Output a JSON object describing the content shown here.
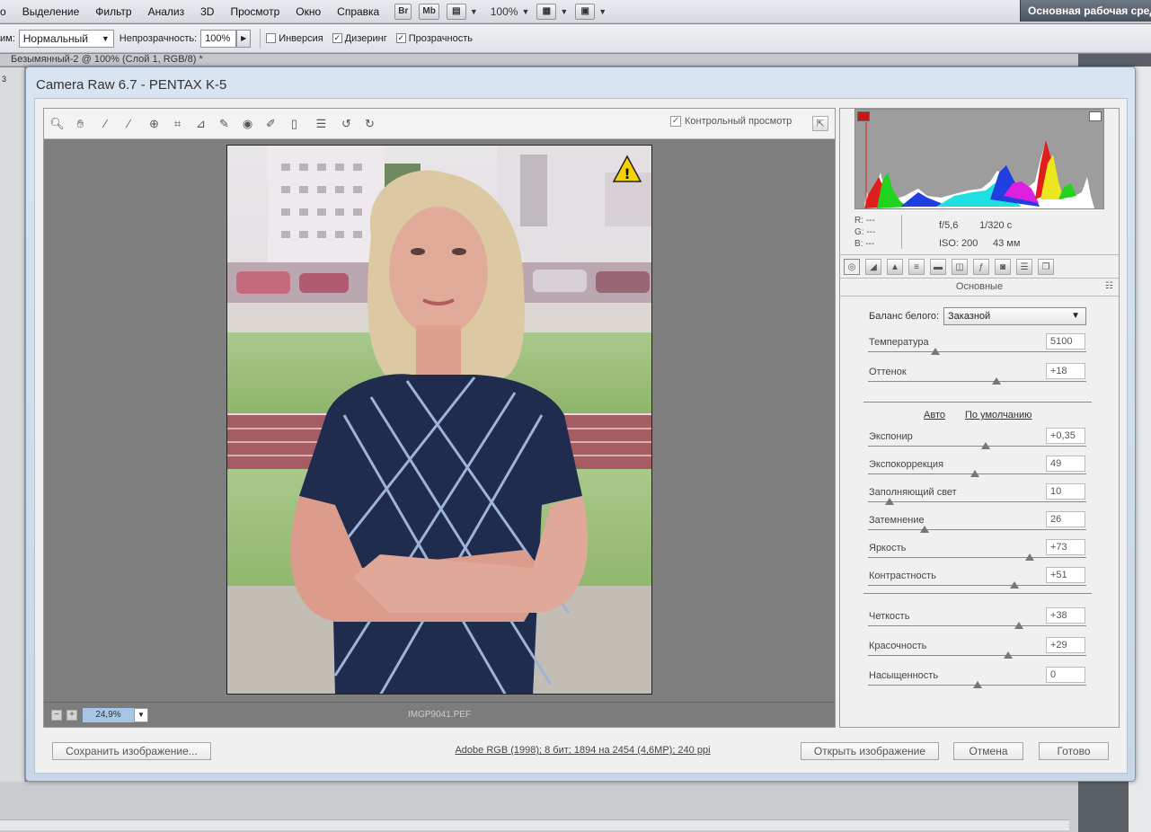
{
  "menubar": {
    "items": [
      "о",
      "Выделение",
      "Фильтр",
      "Анализ",
      "3D",
      "Просмотр",
      "Окно",
      "Справка"
    ],
    "br": "Br",
    "mb": "Mb",
    "zoom": "100%",
    "workspace": "Основная рабочая сред"
  },
  "options": {
    "mode_label": "им:",
    "mode_value": "Нормальный",
    "opacity_label": "Непрозрачность:",
    "opacity_value": "100%",
    "inverse": "Инверсия",
    "dither": "Дизеринг",
    "transparency": "Прозрачность"
  },
  "doc_tab": "Безымянный-2 @ 100% (Слой 1, RGB/8) *",
  "ruler_mark": "3",
  "acr": {
    "title": "Camera Raw 6.7  -  PENTAX K-5",
    "preview_label": "Контрольный просмотр",
    "zoom": "24,9%",
    "filename": "IMGP9041.PEF",
    "histogram_readout": {
      "r": "R:   ---",
      "g": "G:   ---",
      "b": "B:   ---",
      "aperture": "f/5,6",
      "shutter": "1/320 с",
      "iso": "ISO: 200",
      "focal": "43 мм"
    },
    "panel_title": "Основные",
    "white_balance_label": "Баланс белого:",
    "white_balance_value": "Заказной",
    "auto": "Авто",
    "default": "По умолчанию",
    "sliders_group1": [
      {
        "label": "Температура",
        "value": "5100",
        "pos": 0.31
      },
      {
        "label": "Оттенок",
        "value": "+18",
        "pos": 0.59
      }
    ],
    "sliders_group2": [
      {
        "label": "Экспонир",
        "value": "+0,35",
        "pos": 0.54
      },
      {
        "label": "Экспокоррекция",
        "value": "49",
        "pos": 0.49
      },
      {
        "label": "Заполняющий свет",
        "value": "10",
        "pos": 0.1
      },
      {
        "label": "Затемнение",
        "value": "26",
        "pos": 0.26
      },
      {
        "label": "Яркость",
        "value": "+73",
        "pos": 0.74
      },
      {
        "label": "Контрастность",
        "value": "+51",
        "pos": 0.67
      }
    ],
    "sliders_group3": [
      {
        "label": "Четкость",
        "value": "+38",
        "pos": 0.69
      },
      {
        "label": "Красочность",
        "value": "+29",
        "pos": 0.64
      },
      {
        "label": "Насыщенность",
        "value": "0",
        "pos": 0.5
      }
    ],
    "save_btn": "Сохранить изображение...",
    "workflow": "Adobe RGB (1998); 8 бит; 1894 на 2454 (4,6MP); 240 ppi",
    "open_btn": "Открыть изображение",
    "cancel_btn": "Отмена",
    "done_btn": "Готово"
  },
  "colors": {
    "accent": "#a7c6e6",
    "window_frame": "#d8e4f1"
  }
}
